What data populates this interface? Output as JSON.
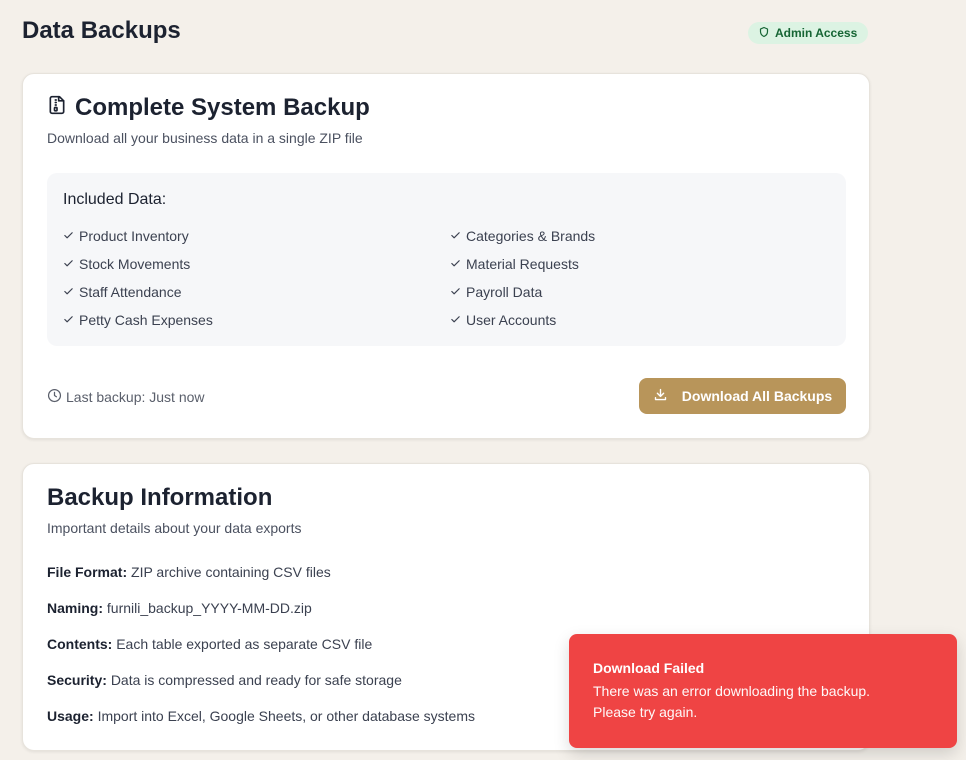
{
  "header": {
    "title": "Data Backups",
    "badge": "Admin Access"
  },
  "backup_card": {
    "title": "Complete System Backup",
    "subtitle": "Download all your business data in a single ZIP file",
    "included_title": "Included Data:",
    "included_left": [
      "Product Inventory",
      "Stock Movements",
      "Staff Attendance",
      "Petty Cash Expenses"
    ],
    "included_right": [
      "Categories & Brands",
      "Material Requests",
      "Payroll Data",
      "User Accounts"
    ],
    "last_backup": "Last backup: Just now",
    "download_label": "Download All Backups"
  },
  "info_card": {
    "title": "Backup Information",
    "subtitle": "Important details about your data exports",
    "rows": [
      {
        "label": "File Format:",
        "value": "ZIP archive containing CSV files"
      },
      {
        "label": "Naming:",
        "value": "furnili_backup_YYYY-MM-DD.zip"
      },
      {
        "label": "Contents:",
        "value": "Each table exported as separate CSV file"
      },
      {
        "label": "Security:",
        "value": "Data is compressed and ready for safe storage"
      },
      {
        "label": "Usage:",
        "value": "Import into Excel, Google Sheets, or other database systems"
      }
    ]
  },
  "toast": {
    "title": "Download Failed",
    "message": "There was an error downloading the backup. Please try again."
  },
  "colors": {
    "page_bg": "#f4f0ea",
    "accent": "#b8955a",
    "badge_bg": "#dcf3e3",
    "badge_text": "#166534",
    "error": "#ef4444"
  },
  "icons": {
    "badge": "shield-icon",
    "card_title": "file-archive-icon",
    "check": "check-icon",
    "clock": "clock-icon",
    "download": "download-icon"
  }
}
